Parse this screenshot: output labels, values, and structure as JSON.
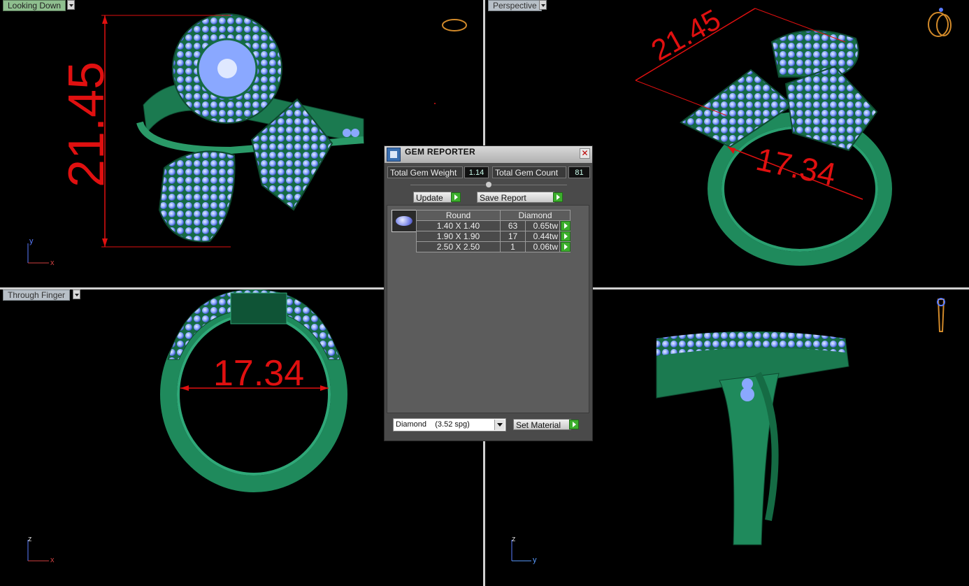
{
  "viewports": {
    "top_left": {
      "label": "Looking Down",
      "dimension": "21.45",
      "axis_v": "y",
      "axis_h": "x"
    },
    "top_right": {
      "label": "Perspective",
      "dimension_a": "21.45",
      "dimension_b": "17.34"
    },
    "bottom_left": {
      "label": "Through Finger",
      "dimension": "17.34",
      "axis_v": "z",
      "axis_h": "x"
    },
    "bottom_right": {
      "label": "",
      "axis_v": "z",
      "axis_h": "y"
    }
  },
  "dialog": {
    "title": "GEM REPORTER",
    "close_glyph": "✕",
    "total_weight_label": "Total Gem Weight",
    "total_weight_value": "1.14",
    "total_count_label": "Total Gem Count",
    "total_count_value": "81",
    "update_label": "Update",
    "save_report_label": "Save Report",
    "table": {
      "headers": [
        "Round",
        "Diamond"
      ],
      "rows": [
        {
          "size": "1.40 X 1.40",
          "count": "63",
          "weight": "0.65tw"
        },
        {
          "size": "1.90 X 1.90",
          "count": "17",
          "weight": "0.44tw"
        },
        {
          "size": "2.50 X 2.50",
          "count": "1",
          "weight": "0.06tw"
        }
      ]
    },
    "material_select": "Diamond    (3.52 spg)",
    "set_material_label": "Set Material"
  },
  "colors": {
    "ring": "#1f8a5c",
    "gem": "#8aa8ff",
    "dimension": "#e01010"
  }
}
